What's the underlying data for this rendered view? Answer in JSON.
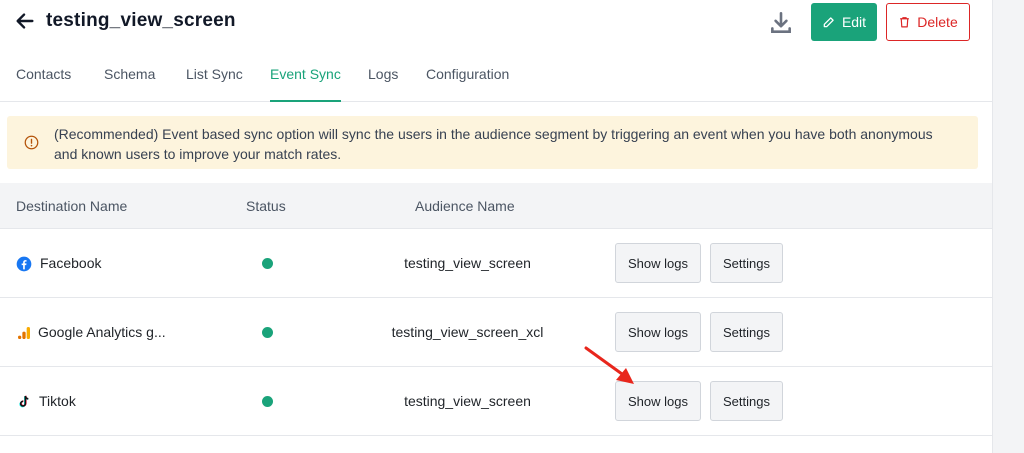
{
  "header": {
    "title": "testing_view_screen",
    "edit_label": "Edit",
    "delete_label": "Delete"
  },
  "tabs": [
    {
      "label": "Contacts",
      "active": false
    },
    {
      "label": "Schema",
      "active": false
    },
    {
      "label": "List Sync",
      "active": false
    },
    {
      "label": "Event Sync",
      "active": true
    },
    {
      "label": "Logs",
      "active": false
    },
    {
      "label": "Configuration",
      "active": false
    }
  ],
  "banner": {
    "text": "(Recommended) Event based sync option will sync the users in the audience segment by triggering an event when you have both anonymous and known users to improve your match rates."
  },
  "table": {
    "columns": [
      "Destination Name",
      "Status",
      "Audience Name"
    ],
    "rows": [
      {
        "destination": "Facebook",
        "icon": "facebook-icon",
        "status": "active",
        "audience": "testing_view_screen",
        "logs_label": "Show logs",
        "settings_label": "Settings"
      },
      {
        "destination": "Google Analytics g...",
        "icon": "google-analytics-icon",
        "status": "active",
        "audience": "testing_view_screen_xcl",
        "logs_label": "Show logs",
        "settings_label": "Settings"
      },
      {
        "destination": "Tiktok",
        "icon": "tiktok-icon",
        "status": "active",
        "audience": "testing_view_screen",
        "logs_label": "Show logs",
        "settings_label": "Settings"
      }
    ]
  },
  "colors": {
    "accent": "#1aa37a",
    "danger": "#dc2626",
    "banner_bg": "#fdf4dd",
    "annotation_arrow": "#e8261c"
  }
}
